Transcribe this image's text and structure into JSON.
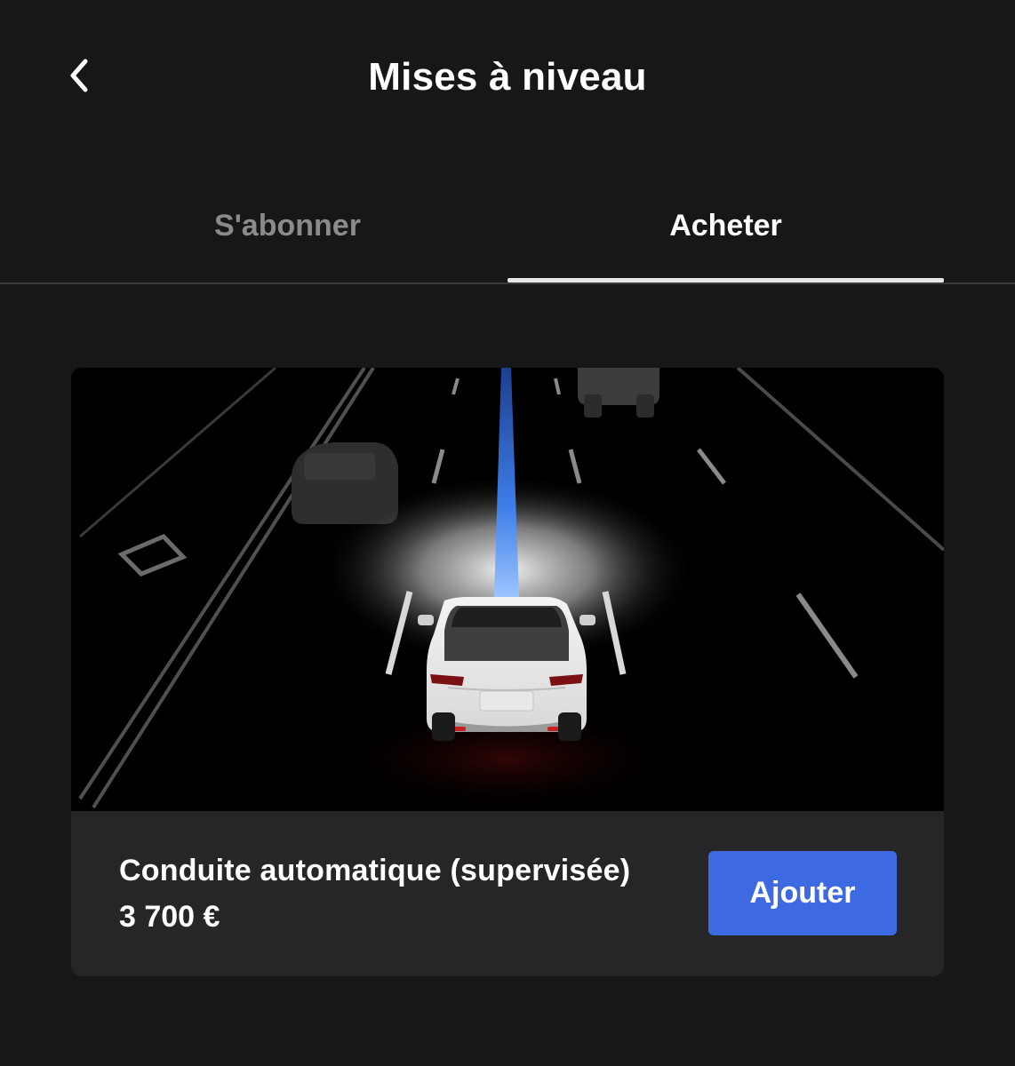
{
  "header": {
    "title": "Mises à niveau",
    "back_icon": "chevron-left-icon"
  },
  "tabs": [
    {
      "label": "S'abonner",
      "active": false
    },
    {
      "label": "Acheter",
      "active": true
    }
  ],
  "product": {
    "name": "Conduite automatique (supervisée)",
    "price": "3 700 €",
    "button_label": "Ajouter",
    "hero_image": "autopilot-highway-visualization"
  },
  "colors": {
    "background": "#171719",
    "card": "#262628",
    "accent": "#3e6ae1",
    "inactive_tab": "#8b8b8e",
    "path_blue": "#3b82f6"
  }
}
